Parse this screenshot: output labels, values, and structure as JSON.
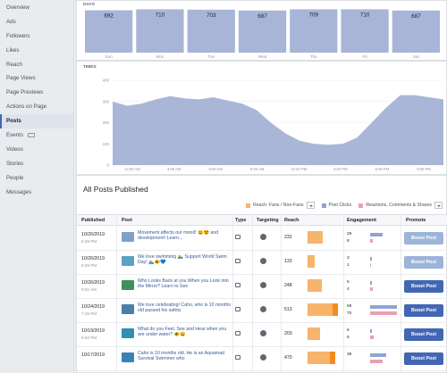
{
  "sidebar": {
    "items": [
      {
        "label": "Overview"
      },
      {
        "label": "Ads"
      },
      {
        "label": "Followers"
      },
      {
        "label": "Likes"
      },
      {
        "label": "Reach"
      },
      {
        "label": "Page Views"
      },
      {
        "label": "Page Previews"
      },
      {
        "label": "Actions on Page"
      },
      {
        "label": "Posts",
        "active": true
      },
      {
        "label": "Events",
        "badge": true
      },
      {
        "label": "Videos"
      },
      {
        "label": "Stories"
      },
      {
        "label": "People"
      },
      {
        "label": "Messages"
      }
    ]
  },
  "days_chart": {
    "label": "DAYS",
    "bar_color": "#a8b5d8",
    "chart_data": {
      "type": "bar",
      "categories": [
        "Sun",
        "Mon",
        "Tue",
        "Wed",
        "Thu",
        "Fri",
        "Sat"
      ],
      "values": [
        692,
        710,
        703,
        687,
        709,
        710,
        687
      ],
      "ylim": [
        0,
        760
      ]
    }
  },
  "times_chart": {
    "label": "TIMES",
    "area_color": "#aab6d8",
    "chart_data": {
      "type": "area",
      "x": [
        0,
        1,
        2,
        3,
        4,
        5,
        6,
        7,
        8,
        9,
        10,
        11,
        12,
        13,
        14,
        15,
        16,
        17,
        18,
        19,
        20,
        21,
        22,
        23
      ],
      "values": [
        300,
        280,
        290,
        310,
        325,
        315,
        310,
        320,
        305,
        290,
        260,
        200,
        150,
        115,
        100,
        95,
        100,
        130,
        200,
        270,
        330,
        330,
        320,
        310
      ],
      "ylim": [
        0,
        400
      ],
      "y_ticks": [
        "0",
        "100",
        "200",
        "300",
        "400"
      ],
      "x_ticks": [
        "12:00 AM",
        "3:00 AM",
        "6:00 AM",
        "9:00 AM",
        "12:00 PM",
        "3:00 PM",
        "6:00 PM",
        "9:00 PM"
      ]
    }
  },
  "posts": {
    "title": "All Posts Published",
    "legend": [
      {
        "label": "Reach: Fans / Non-Fans",
        "color": "#f7b46b",
        "dropdown": true
      },
      {
        "label": "Post Clicks",
        "color": "#8fa3d4",
        "dropdown": false
      },
      {
        "label": "Reactions, Comments & Shares",
        "color": "#e7a1b0",
        "dropdown": true
      }
    ],
    "columns": [
      "Published",
      "Post",
      "Type",
      "Targeting",
      "Reach",
      "Engagement",
      "Promote"
    ],
    "rows": [
      {
        "date": "10/26/2019",
        "time": "6:28 PM",
        "text": "Movement affects our mood! 😄😍 and development! Learn...",
        "reach": "232",
        "reach_fans": 0.6,
        "reach_nonfans": 0,
        "eng1": "29",
        "eng2": "8",
        "clicks": 0.45,
        "reactions": 0.1,
        "boost": "Boost Post",
        "boost_enabled": false,
        "thumb": "#7fa0c8"
      },
      {
        "date": "10/26/2019",
        "time": "5:29 PM",
        "text": "We love swimming 🏊 Support World Swim Day! 🏊🐠💙",
        "reach": "133",
        "reach_fans": 0.3,
        "reach_nonfans": 0,
        "eng1": "3",
        "eng2": "1",
        "clicks": 0.06,
        "reactions": 0.03,
        "boost": "Boost Post",
        "boost_enabled": false,
        "thumb": "#5aa3c2"
      },
      {
        "date": "10/26/2019",
        "time": "9:02 AM",
        "text": "Who Looks Back at you When you Look into the Mirror? Learn to See",
        "reach": "248",
        "reach_fans": 0.58,
        "reach_nonfans": 0,
        "eng1": "5",
        "eng2": "4",
        "clicks": 0.08,
        "reactions": 0.1,
        "boost": "Boost Post",
        "boost_enabled": true,
        "thumb": "#3f8f5a"
      },
      {
        "date": "10/24/2019",
        "time": "7:26 PM",
        "text": "We love celebrating! Caho, who is 10 months old passed his safety",
        "reach": "513",
        "reach_fans": 1.0,
        "reach_nonfans": 0.22,
        "eng1": "68",
        "eng2": "70",
        "clicks": 1.0,
        "reactions": 1.0,
        "boost": "Boost Post",
        "boost_enabled": true,
        "thumb": "#4a7fa8"
      },
      {
        "date": "10/19/2019",
        "time": "6:02 PM",
        "text": "What do you Feel, See and Hear when you are under water? 🐠😄",
        "reach": "203",
        "reach_fans": 0.5,
        "reach_nonfans": 0,
        "eng1": "5",
        "eng2": "6",
        "clicks": 0.08,
        "reactions": 0.12,
        "boost": "Boost Post",
        "boost_enabled": true,
        "thumb": "#2f8fb5"
      },
      {
        "date": "10/17/2019",
        "time": "",
        "text": "Caho is 10 months old. He is an Aquamad Survival Swimmer who",
        "reach": "470",
        "reach_fans": 0.9,
        "reach_nonfans": 0.2,
        "eng1": "38",
        "eng2": "",
        "clicks": 0.6,
        "reactions": 0.45,
        "boost": "Boost Post",
        "boost_enabled": true,
        "thumb": "#3b82b8"
      }
    ]
  }
}
